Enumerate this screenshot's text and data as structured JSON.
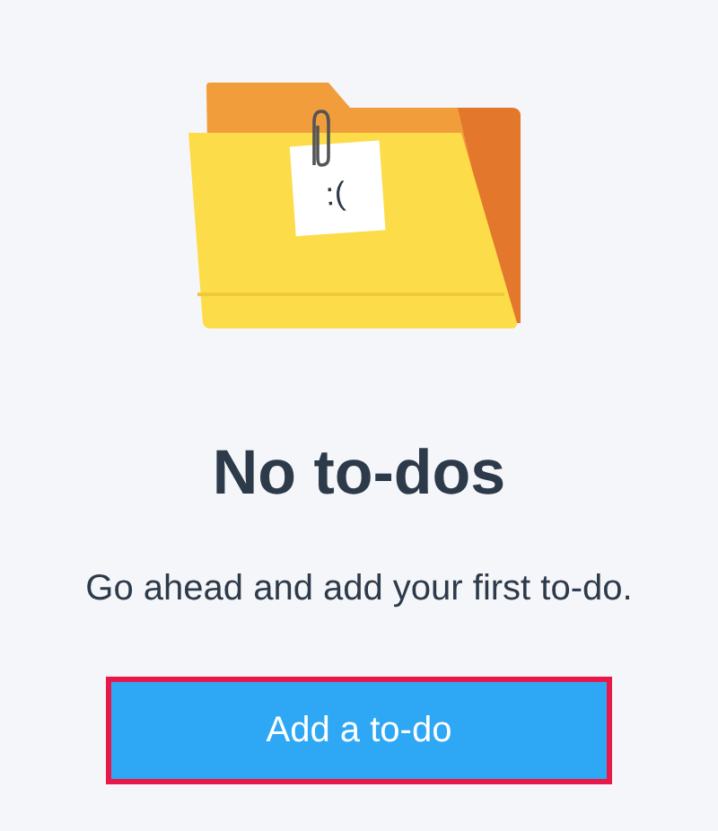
{
  "illustration": {
    "note": ":("
  },
  "title": "No to-dos",
  "message": "Go ahead and add your first to-do.",
  "button": {
    "label": "Add a to-do",
    "highlighted": true
  }
}
